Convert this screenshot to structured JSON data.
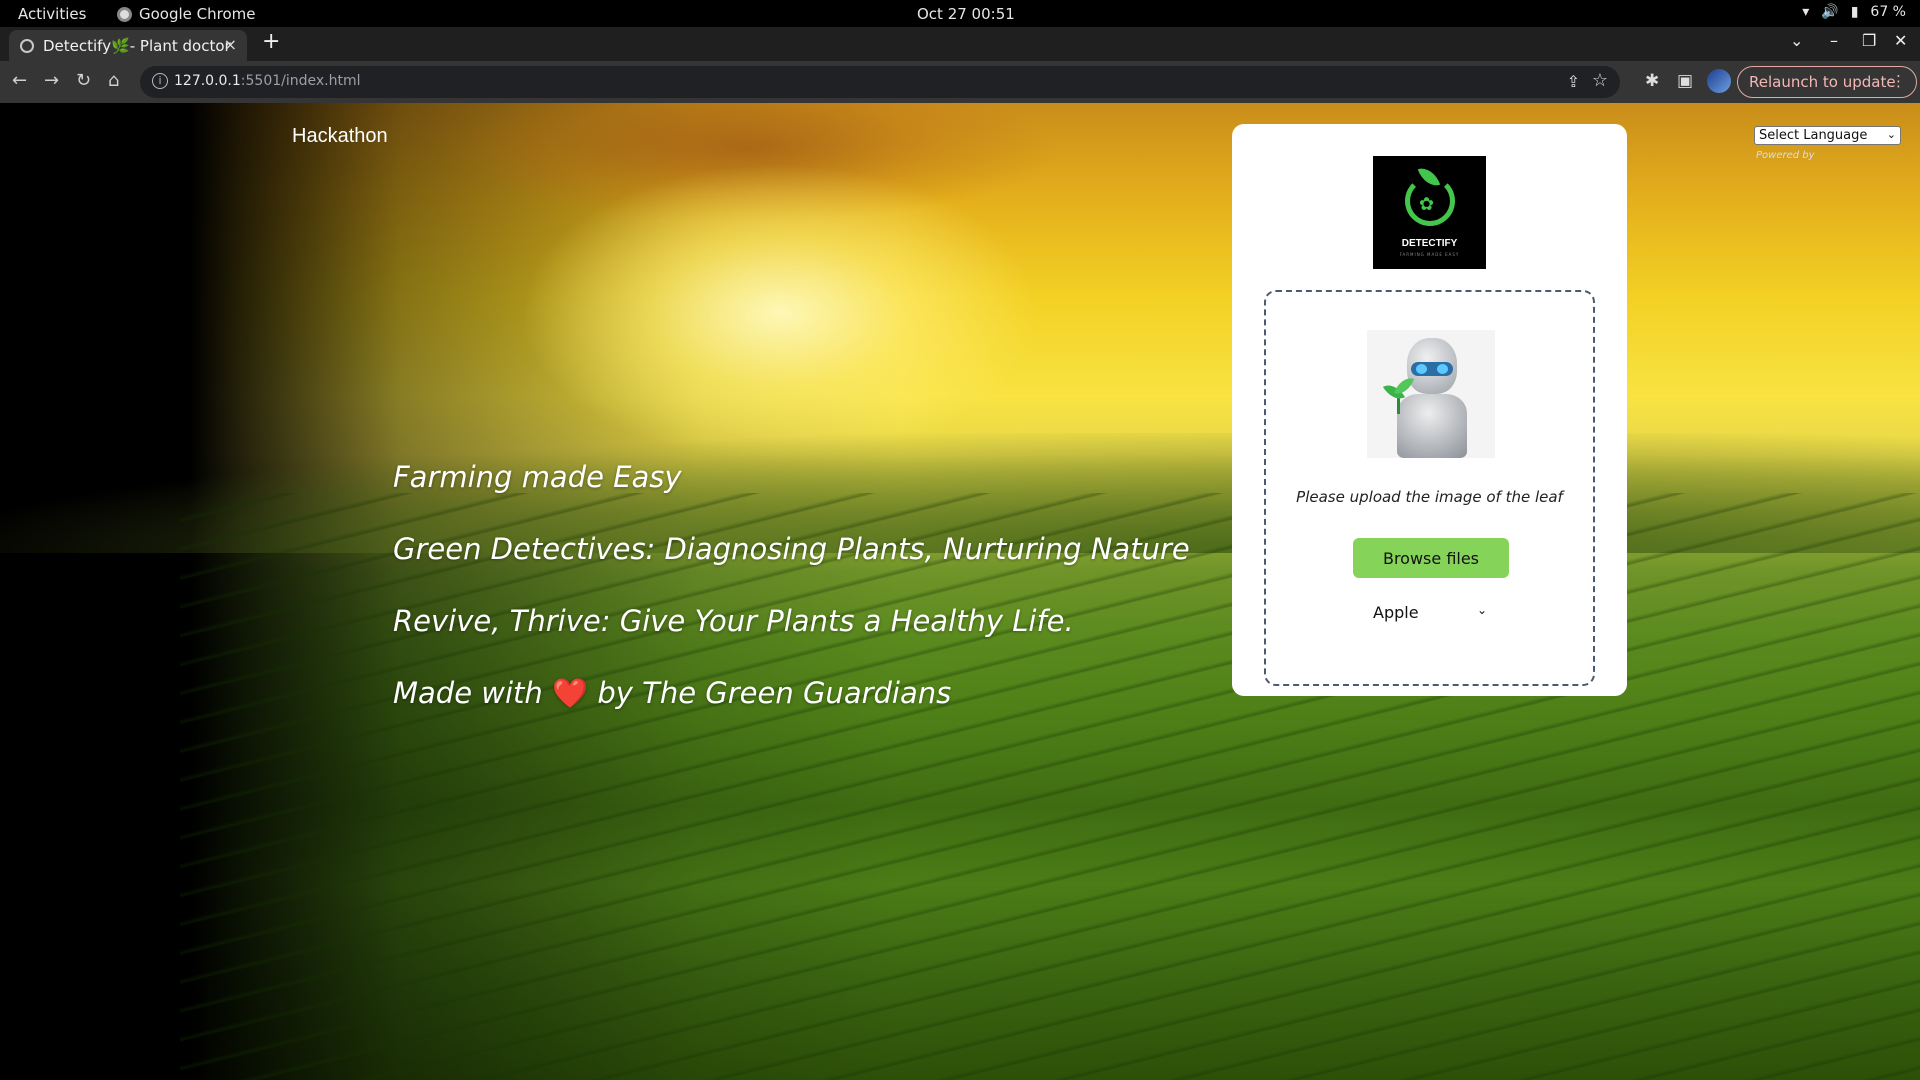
{
  "os_bar": {
    "activities": "Activities",
    "app_name": "Google Chrome",
    "clock": "Oct 27  00:51",
    "battery": "67 %"
  },
  "browser": {
    "tab_title": "Detectify🌿- Plant doctor",
    "tab_close": "×",
    "new_tab": "+",
    "url_host": "127.0.0.1",
    "url_rest": ":5501/index.html",
    "relaunch": "Relaunch to update"
  },
  "page": {
    "brand": "Hackathon",
    "taglines": [
      "Farming made Easy",
      "Green Detectives: Diagnosing Plants, Nurturing Nature",
      "Revive, Thrive: Give Your Plants a Healthy Life.",
      "Made with",
      "by The Green Guardians"
    ],
    "heart": "❤️",
    "logo_name": "DETECTIFY",
    "logo_sub": "FARMING MADE EASY",
    "upload_prompt": "Please upload the image of the leaf",
    "browse_label": "Browse files",
    "plant_selected": "Apple",
    "language_select": "Select Language",
    "powered_by": "Powered by"
  },
  "colors": {
    "accent_button": "#86d35a",
    "relaunch_text": "#f2b8b5"
  }
}
